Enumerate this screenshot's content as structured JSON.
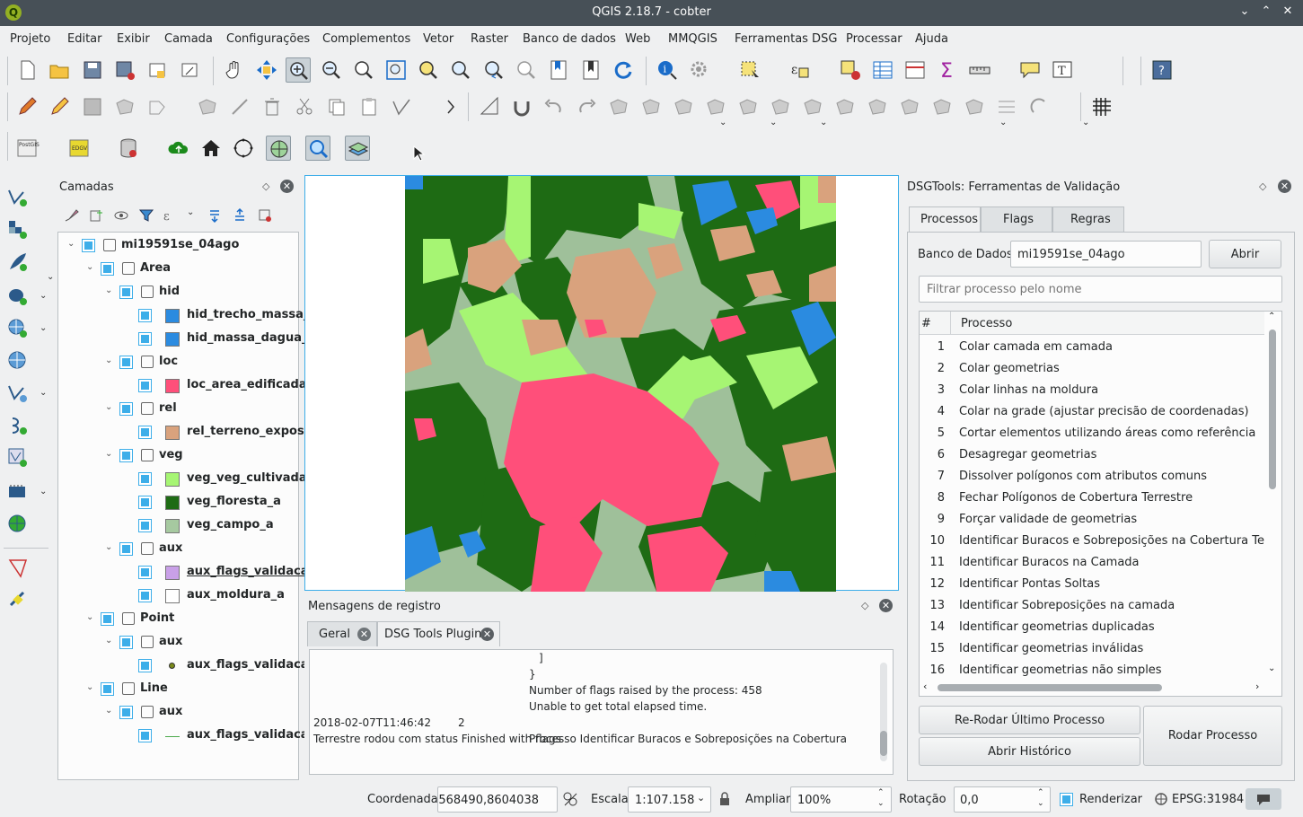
{
  "window": {
    "title": "QGIS 2.18.7 - cobter",
    "logo": "Q"
  },
  "window_controls": [
    "⌄",
    "⌃",
    "✕"
  ],
  "menu": [
    "Projeto",
    "Editar",
    "Exibir",
    "Camada",
    "Configurações",
    "Complementos",
    "Vetor",
    "Raster",
    "Banco de dados",
    "Web",
    "MMQGIS",
    "Ferramentas DSG",
    "Processar",
    "Ajuda"
  ],
  "layers_panel": {
    "title": "Camadas",
    "tree": [
      {
        "label": "mi19591se_04ago",
        "level": 0,
        "type": "group",
        "bold": true
      },
      {
        "label": "Area",
        "level": 1,
        "type": "group",
        "bold": true
      },
      {
        "label": "hid",
        "level": 2,
        "type": "group",
        "bold": true
      },
      {
        "label": "hid_trecho_massa_...",
        "level": 3,
        "type": "layer",
        "color": "#2b8be0",
        "bold": true
      },
      {
        "label": "hid_massa_dagua_a",
        "level": 3,
        "type": "layer",
        "color": "#2b8be0",
        "bold": true
      },
      {
        "label": "loc",
        "level": 2,
        "type": "group",
        "bold": true
      },
      {
        "label": "loc_area_edificada_a",
        "level": 3,
        "type": "layer",
        "color": "#ff4f7a",
        "bold": true
      },
      {
        "label": "rel",
        "level": 2,
        "type": "group",
        "bold": true
      },
      {
        "label": "rel_terreno_expos...",
        "level": 3,
        "type": "layer",
        "color": "#d9a27d",
        "bold": true
      },
      {
        "label": "veg",
        "level": 2,
        "type": "group",
        "bold": true
      },
      {
        "label": "veg_veg_cultivada_a",
        "level": 3,
        "type": "layer",
        "color": "#a6f573",
        "bold": true
      },
      {
        "label": "veg_floresta_a",
        "level": 3,
        "type": "layer",
        "color": "#1e6b14",
        "bold": true
      },
      {
        "label": "veg_campo_a",
        "level": 3,
        "type": "layer",
        "color": "#a6c9a0",
        "bold": true
      },
      {
        "label": "aux",
        "level": 2,
        "type": "group",
        "bold": true
      },
      {
        "label": "aux_flags_validaca...",
        "level": 3,
        "type": "layer",
        "color": "#c9a0e8",
        "bold": true,
        "underline": true
      },
      {
        "label": "aux_moldura_a",
        "level": 3,
        "type": "layer",
        "color": "#ffffff",
        "bold": true
      },
      {
        "label": "Point",
        "level": 1,
        "type": "group",
        "bold": true
      },
      {
        "label": "aux",
        "level": 2,
        "type": "group",
        "bold": true
      },
      {
        "label": "aux_flags_validaca...",
        "level": 3,
        "type": "point",
        "color": "#7a8a1a",
        "bold": true
      },
      {
        "label": "Line",
        "level": 1,
        "type": "group",
        "bold": true
      },
      {
        "label": "aux",
        "level": 2,
        "type": "group",
        "bold": true
      },
      {
        "label": "aux_flags_validaca...",
        "level": 3,
        "type": "line",
        "color": "#4caa4c",
        "bold": true
      }
    ]
  },
  "log_panel": {
    "title": "Mensagens de registro",
    "tabs": [
      "Geral",
      "DSG Tools Plugin"
    ],
    "lines": [
      {
        "col": 3,
        "text": "]"
      },
      {
        "col": 2,
        "text": "}"
      },
      {
        "col": 2,
        "text": "Number of flags raised by the process: 458"
      },
      {
        "col": 2,
        "text": "Unable to get total elapsed time."
      },
      {
        "col": 0,
        "text": "2018-02-07T11:46:42"
      },
      {
        "col": 1,
        "text": "2"
      },
      {
        "col": 2,
        "text": "Processo Identificar Buracos e Sobreposições na Cobertura"
      },
      {
        "col": 0,
        "text": "Terrestre rodou com status Finished with flags"
      }
    ]
  },
  "dsg_panel": {
    "title": "DSGTools: Ferramentas de Validação",
    "tabs": [
      "Processos",
      "Flags",
      "Regras"
    ],
    "db_label": "Banco de Dados",
    "db_value": "mi19591se_04ago",
    "open_button": "Abrir",
    "filter_placeholder": "Filtrar processo pelo nome",
    "col_num": "#",
    "col_process": "Processo",
    "processes": [
      "Colar camada em camada",
      "Colar geometrias",
      "Colar linhas na moldura",
      "Colar na grade (ajustar precisão de coordenadas)",
      "Cortar elementos utilizando áreas como referência",
      "Desagregar geometrias",
      "Dissolver polígonos com atributos comuns",
      "Fechar Polígonos de Cobertura Terrestre",
      "Forçar validade de geometrias",
      "Identificar Buracos e Sobreposições na Cobertura Terrest",
      "Identificar Buracos na Camada",
      "Identificar Pontas Soltas",
      "Identificar Sobreposições na camada",
      "Identificar geometrias duplicadas",
      "Identificar geometrias inválidas",
      "Identificar geometrias não simples"
    ],
    "rerun_button": "Re-Rodar Último Processo",
    "history_button": "Abrir Histórico",
    "run_button": "Rodar Processo"
  },
  "statusbar": {
    "coord_label": "Coordenada",
    "coord_value": "568490,8604038",
    "scale_label": "Escala",
    "scale_value": "1:107.158",
    "zoom_label": "Ampliar",
    "zoom_value": "100%",
    "rotation_label": "Rotação",
    "rotation_value": "0,0",
    "render_label": "Renderizar",
    "crs": "EPSG:31984"
  },
  "colors": {
    "accent": "#3daee9",
    "forest": "#1e6b14",
    "field": "#a6c9a0",
    "cultivated": "#a6f573",
    "urban": "#ff4f7a",
    "exposed": "#d9a27d",
    "water": "#2b8be0"
  }
}
